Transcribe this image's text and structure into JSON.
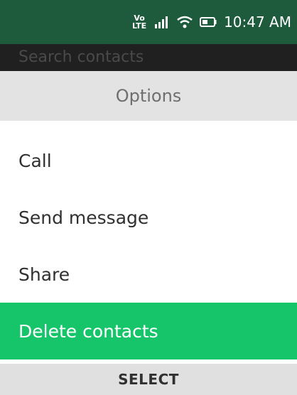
{
  "status_bar": {
    "network_badge": "Vo LTE",
    "icons": [
      "volte-icon",
      "signal-icon",
      "wifi-icon",
      "battery-icon"
    ],
    "time": "10:47 AM"
  },
  "search": {
    "placeholder": "Search contacts"
  },
  "options": {
    "title": "Options",
    "items": [
      {
        "label": "Call"
      },
      {
        "label": "Send message"
      },
      {
        "label": "Share"
      },
      {
        "label": "Delete contacts",
        "selected": true
      }
    ]
  },
  "softkeys": {
    "center": "SELECT"
  },
  "colors": {
    "status_bar": "#1e5b3c",
    "highlight": "#16c46a",
    "header_bg": "#e3e3e3"
  }
}
